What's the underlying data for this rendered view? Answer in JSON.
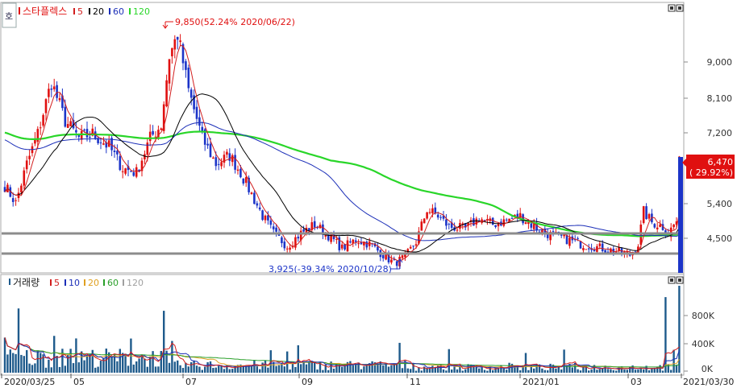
{
  "title_badge": "호",
  "price_panel": {
    "stock_name": "스타플렉스",
    "ma_legend": [
      {
        "period": "5",
        "color": "#d21e1e"
      },
      {
        "period": "20",
        "color": "#000000"
      },
      {
        "period": "60",
        "color": "#1c2fb8"
      },
      {
        "period": "120",
        "color": "#29d629"
      }
    ],
    "y_ticks": [
      "9,000",
      "8,100",
      "7,200",
      "6,300",
      "5,400",
      "4,500"
    ],
    "high_annotation": "9,850(52.24% 2020/06/22)",
    "low_annotation": "3,925(-39.34% 2020/10/28)",
    "last_price": "6,470",
    "last_change": "( 29.92%)"
  },
  "volume_panel": {
    "title": "거래량",
    "ma_legend": [
      {
        "period": "5",
        "color": "#d21e1e"
      },
      {
        "period": "10",
        "color": "#1c2fb8"
      },
      {
        "period": "20",
        "color": "#e0a020"
      },
      {
        "period": "60",
        "color": "#2aa02a"
      },
      {
        "period": "120",
        "color": "#a0a0a0"
      }
    ],
    "y_ticks": [
      "800K",
      "400K",
      "0K"
    ]
  },
  "x_labels": [
    "2020/03/25",
    "05",
    "07",
    "09",
    "11",
    "2021/01",
    "03",
    "2021/03/30"
  ],
  "colors": {
    "up": "#e01010",
    "down": "#1c34c8",
    "volume": "#1f5b8c",
    "support": "#8c8c8c"
  },
  "chart_data": {
    "type": "candlestick",
    "x_range": [
      "2020/03/25",
      "2021/03/30"
    ],
    "price_ylim": [
      3800,
      10000
    ],
    "price_ticks": [
      9000,
      8100,
      7200,
      6300,
      5400,
      4500
    ],
    "volume_ylim": [
      0,
      1150000
    ],
    "volume_ticks": [
      800000,
      400000,
      0
    ],
    "high": {
      "value": 9850,
      "change_pct": 52.24,
      "date": "2020/06/22"
    },
    "low": {
      "value": 3925,
      "change_pct": -39.34,
      "date": "2020/10/28"
    },
    "last": {
      "value": 6470,
      "change_pct": 29.92,
      "date": "2021/03/30"
    },
    "support_lines": [
      4650,
      4130
    ],
    "close_keypoints": [
      [
        0,
        5800
      ],
      [
        4,
        5400
      ],
      [
        8,
        6300
      ],
      [
        12,
        7000
      ],
      [
        17,
        8200
      ],
      [
        22,
        7300
      ],
      [
        27,
        6900
      ],
      [
        32,
        7000
      ],
      [
        38,
        6700
      ],
      [
        43,
        6200
      ],
      [
        48,
        6100
      ],
      [
        53,
        6900
      ],
      [
        57,
        7200
      ],
      [
        60,
        8800
      ],
      [
        63,
        9300
      ],
      [
        67,
        8000
      ],
      [
        72,
        6900
      ],
      [
        77,
        6300
      ],
      [
        82,
        6500
      ],
      [
        86,
        6100
      ],
      [
        90,
        5600
      ],
      [
        94,
        5100
      ],
      [
        98,
        4700
      ],
      [
        103,
        4400
      ],
      [
        108,
        4700
      ],
      [
        113,
        4900
      ],
      [
        118,
        4650
      ],
      [
        123,
        4350
      ],
      [
        128,
        4550
      ],
      [
        133,
        4450
      ],
      [
        138,
        4200
      ],
      [
        142,
        4000
      ],
      [
        146,
        4150
      ],
      [
        150,
        4500
      ],
      [
        154,
        5250
      ],
      [
        158,
        5100
      ],
      [
        162,
        4850
      ],
      [
        168,
        4800
      ],
      [
        173,
        5050
      ],
      [
        178,
        4900
      ],
      [
        183,
        5000
      ],
      [
        188,
        5100
      ],
      [
        192,
        4900
      ],
      [
        197,
        4700
      ],
      [
        203,
        4600
      ],
      [
        210,
        4450
      ],
      [
        218,
        4350
      ],
      [
        225,
        4250
      ],
      [
        228,
        4200
      ],
      [
        231,
        4450
      ],
      [
        233,
        5200
      ],
      [
        236,
        4950
      ],
      [
        240,
        4850
      ],
      [
        242,
        4700
      ],
      [
        245,
        4980
      ],
      [
        246,
        6470
      ]
    ],
    "volume_spikes": [
      {
        "index": 241,
        "value": 1000000
      },
      {
        "index": 246,
        "value": 1150000
      },
      {
        "index": 61,
        "value": 420000
      },
      {
        "index": 5,
        "value": 850000
      }
    ]
  }
}
